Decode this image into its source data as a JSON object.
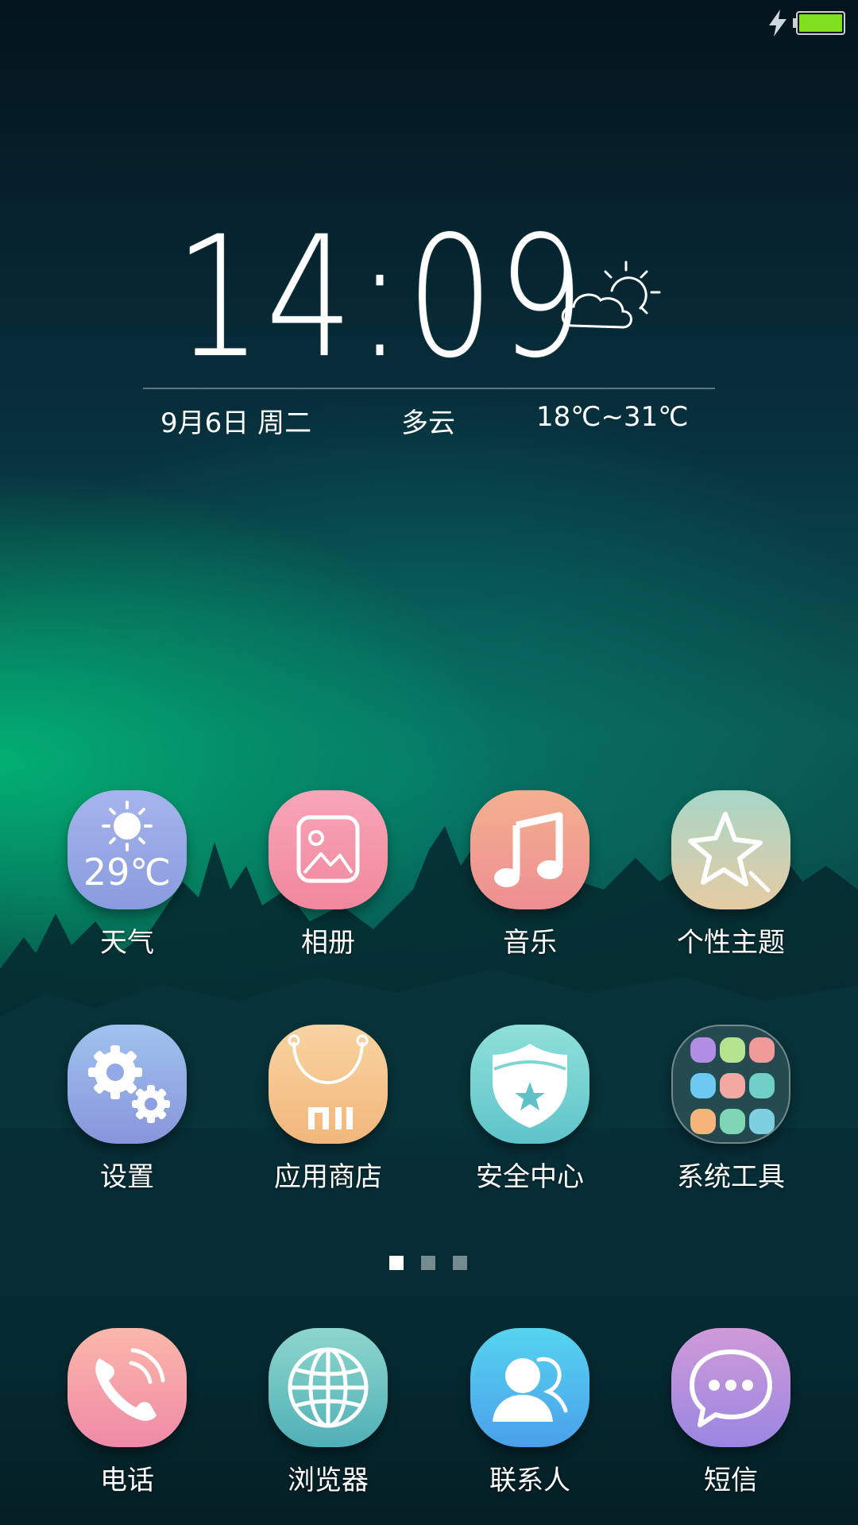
{
  "status_bar": {
    "charging_icon": "lightning-bolt-icon",
    "battery_icon": "battery-full-icon",
    "battery_color": "#7ee01f"
  },
  "clock": {
    "time": "14:09",
    "weather_icon": "partly-cloudy-icon",
    "date": "9月6日  周二",
    "condition": "多云",
    "temp_range": "18℃~31℃"
  },
  "apps": [
    {
      "label": "天气",
      "temp": "29℃",
      "icon": "sun-icon"
    },
    {
      "label": "相册",
      "icon": "image-icon"
    },
    {
      "label": "音乐",
      "icon": "music-note-icon"
    },
    {
      "label": "个性主题",
      "icon": "star-icon"
    },
    {
      "label": "设置",
      "icon": "gears-icon"
    },
    {
      "label": "应用商店",
      "icon": "shopping-bag-icon"
    },
    {
      "label": "安全中心",
      "icon": "shield-star-icon"
    },
    {
      "label": "系统工具",
      "icon": "folder-icon"
    }
  ],
  "dock": [
    {
      "label": "电话",
      "icon": "phone-icon"
    },
    {
      "label": "浏览器",
      "icon": "globe-icon"
    },
    {
      "label": "联系人",
      "icon": "contacts-icon"
    },
    {
      "label": "短信",
      "icon": "chat-bubble-icon"
    }
  ],
  "page_indicator": {
    "pages": 3,
    "current": 1
  }
}
